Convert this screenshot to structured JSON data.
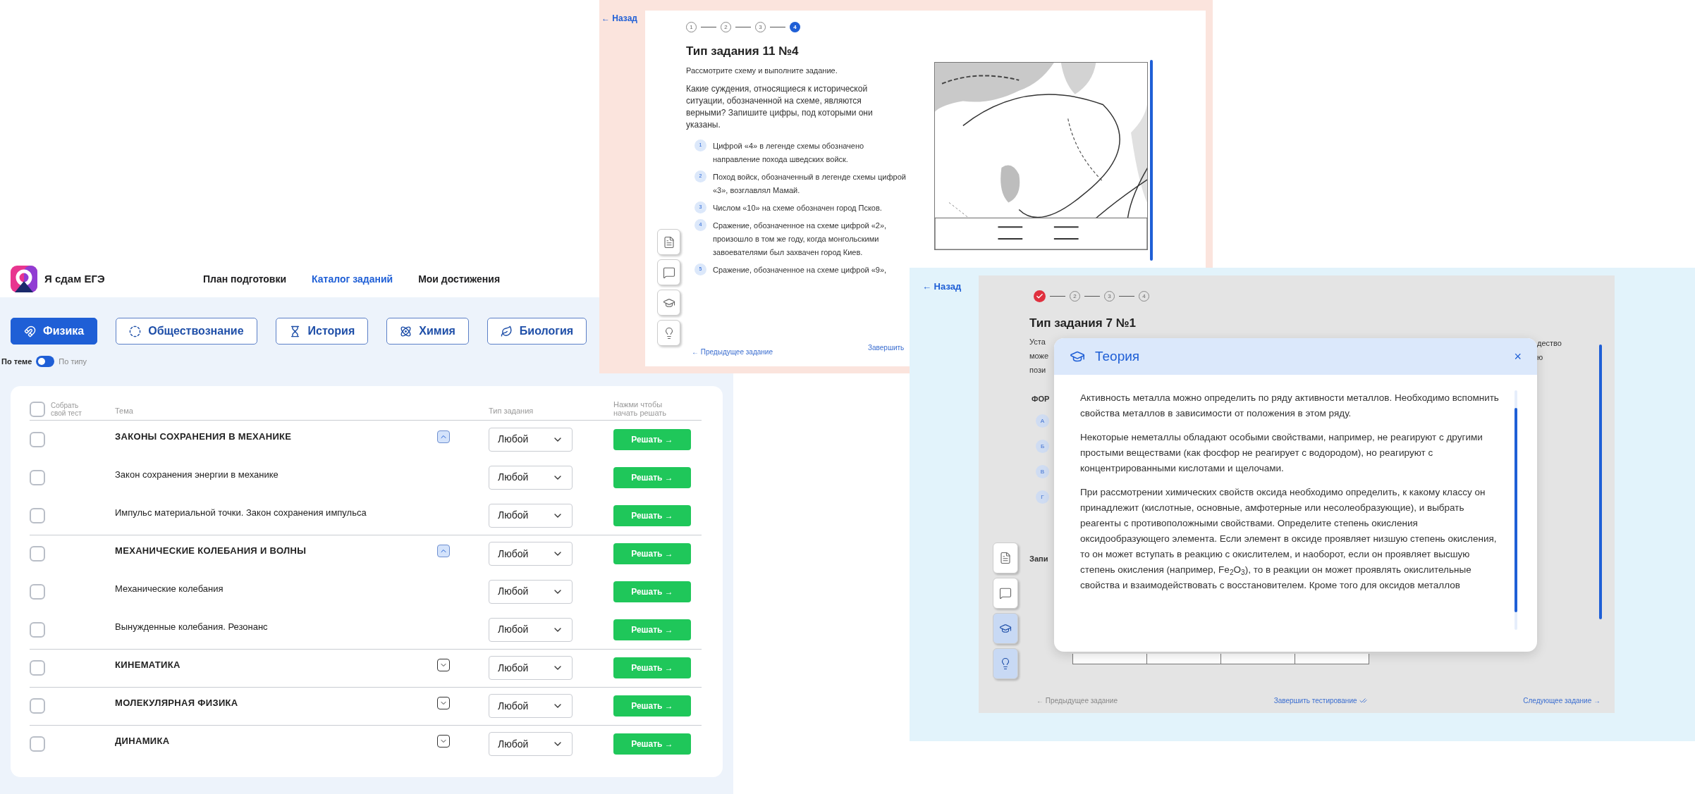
{
  "catalog_window": {
    "logo_text": "Я сдам ЕГЭ",
    "nav": [
      {
        "label": "План подготовки",
        "selected": false
      },
      {
        "label": "Каталог заданий",
        "selected": true
      },
      {
        "label": "Мои достижения",
        "selected": false
      }
    ],
    "subjects": [
      {
        "label": "Физика",
        "selected": true
      },
      {
        "label": "Обществознание",
        "selected": false
      },
      {
        "label": "История",
        "selected": false
      },
      {
        "label": "Химия",
        "selected": false
      },
      {
        "label": "Биология",
        "selected": false
      }
    ],
    "mode_toggle": {
      "left_label": "По теме",
      "right_label": "По типу",
      "on": false
    },
    "table": {
      "select_all": {
        "label": "Собрать свой тест",
        "checked": false
      },
      "columns": [
        "Тема",
        "Тип задания",
        "Нажми чтобы начать решать"
      ],
      "rows": [
        {
          "title": "ЗАКОНЫ СОХРАНЕНИЯ В МЕХАНИКЕ",
          "checked": false,
          "expanded": true,
          "type": "Любой",
          "action": "Решать →",
          "children": [
            {
              "title": "Закон сохранения энергии в механике",
              "checked": false,
              "type": "Любой",
              "action": "Решать →"
            },
            {
              "title": "Импульс материальной точки. Закон сохранения импульса",
              "checked": false,
              "type": "Любой",
              "action": "Решать →"
            }
          ]
        },
        {
          "title": "МЕХАНИЧЕСКИЕ КОЛЕБАНИЯ И ВОЛНЫ",
          "checked": false,
          "expanded": true,
          "type": "Любой",
          "action": "Решать →",
          "children": [
            {
              "title": "Механические колебания",
              "checked": false,
              "type": "Любой",
              "action": "Решать →"
            },
            {
              "title": "Вынужденные колебания. Резонанс",
              "checked": false,
              "type": "Любой",
              "action": "Решать →"
            }
          ]
        },
        {
          "title": "КИНЕМАТИКА",
          "checked": false,
          "expanded": false,
          "type": "Любой",
          "action": "Решать →"
        },
        {
          "title": "МОЛЕКУЛЯРНАЯ ФИЗИКА",
          "checked": false,
          "expanded": false,
          "type": "Любой",
          "action": "Решать →"
        },
        {
          "title": "ДИНАМИКА",
          "checked": false,
          "expanded": false,
          "type": "Любой",
          "action": "Решать →"
        }
      ]
    }
  },
  "history_task_window": {
    "back": "← Назад",
    "steps": [
      {
        "label": "1",
        "done": false,
        "current": false
      },
      {
        "label": "2",
        "done": false,
        "current": false
      },
      {
        "label": "3",
        "done": false,
        "current": false
      },
      {
        "label": "4",
        "done": false,
        "current": true
      }
    ],
    "title": "Тип задания 11 №4",
    "intro": "Рассмотрите схему и выполните задание.",
    "question": "Какие суждения, относящиеся к исторической ситуации, обозначенной на схеме, являются верными? Запишите цифры, под которыми они указаны.",
    "options": [
      {
        "number": "1",
        "text": "Цифрой «4» в легенде схемы обозначено направление похода шведских войск."
      },
      {
        "number": "2",
        "text": "Поход войск, обозначенный в легенде схемы цифрой «3», возглавлял Мамай."
      },
      {
        "number": "3",
        "text": "Числом «10» на схеме обозначен город Псков."
      },
      {
        "number": "4",
        "text": "Сражение, обозначенное на схеме цифрой «2», произошло в том же году, когда монгольскими завоевателями был захвачен город Киев."
      },
      {
        "number": "5",
        "text": "Сражение, обозначенное на схеме цифрой «9»,"
      }
    ],
    "tools": [
      {
        "selected": false
      },
      {
        "selected": false
      },
      {
        "selected": false
      },
      {
        "selected": false
      }
    ],
    "prev": "← Предыдущее задание",
    "finish": "Завершить"
  },
  "chemistry_task_window": {
    "back": "← Назад",
    "steps": [
      {
        "done": true,
        "current": false
      },
      {
        "label": "2",
        "done": false,
        "current": false
      },
      {
        "label": "3",
        "done": false,
        "current": false
      },
      {
        "label": "4",
        "done": false,
        "current": false
      }
    ],
    "title": "Тип задания 7 №1",
    "hidden_lines": [
      {
        "left": "Уста",
        "right": "дество"
      },
      {
        "left": "може",
        "right": "ю"
      },
      {
        "left": "пози"
      }
    ],
    "section_label": "ФОР",
    "option_letters": [
      "А",
      "Б",
      "В",
      "Г"
    ],
    "answer_label": "Запи",
    "tools": [
      {
        "selected": false
      },
      {
        "selected": false
      },
      {
        "selected": true
      },
      {
        "selected": true
      }
    ],
    "prev": "← Предыдущее задание",
    "finish": "Завершить тестирование",
    "next": "Следующее задание →",
    "theory_modal": {
      "title": "Теория",
      "close": "×",
      "paragraphs": [
        "Активность металла можно определить по ряду активности металлов. Необходимо вспомнить свойства металлов в зависимости от положения в этом ряду.",
        "Некоторые неметаллы обладают особыми свойствами, например, не реагируют с другими простыми веществами (как фосфор не реагирует с водородом), но реагируют с концентрированными кислотами и щелочами.",
        "При рассмотрении химических свойств оксида необходимо определить, к какому классу он принадлежит (кислотные, основные, амфотерные или несолеобразующие), и выбрать реагенты с противоположными свойствами. Определите степень окисления оксидообразующего элемента. Если элемент в оксиде проявляет низшую степень окисления, то он может вступать в реакцию с окислителем, и наоборот, если он проявляет высшую степень окисления (например, Fe$_{2}$O$_{3}$), то в реакции он может проявлять окислительные свойства и взаимодействовать с восстановителем. Кроме того для оксидов металлов"
      ]
    }
  }
}
